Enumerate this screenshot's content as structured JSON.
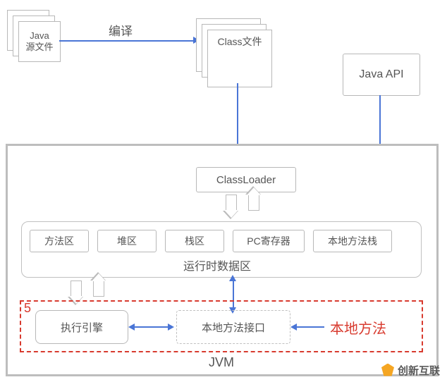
{
  "source": {
    "line1": "Java",
    "line2": "源文件"
  },
  "compile_label": "编译",
  "class_file": "Class文件",
  "java_api": "Java API",
  "class_loader": "ClassLoader",
  "runtime": {
    "method_area": "方法区",
    "heap": "堆区",
    "stack": "栈区",
    "pc_register": "PC寄存器",
    "native_stack": "本地方法栈",
    "label": "运行时数据区"
  },
  "section5": "5",
  "exec_engine": "执行引擎",
  "native_interface": "本地方法接口",
  "native_method": "本地方法",
  "jvm_label": "JVM",
  "watermark": "创新互联"
}
